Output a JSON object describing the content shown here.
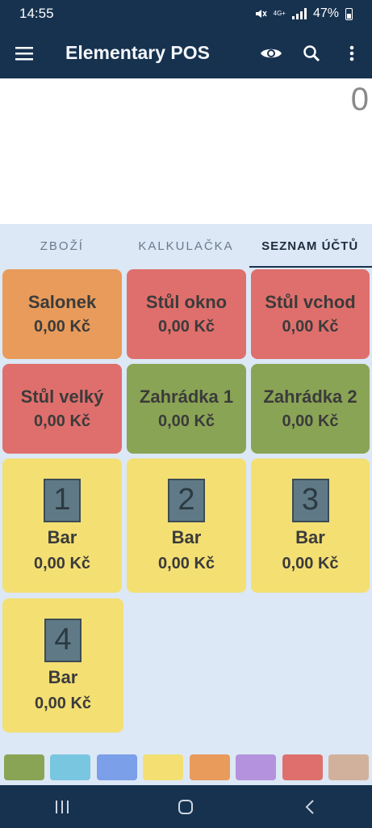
{
  "status": {
    "time": "14:55",
    "network": "4G+",
    "battery": "47%"
  },
  "app": {
    "title": "Elementary POS"
  },
  "display": {
    "value": "0"
  },
  "tabs": [
    {
      "label": "ZBOŽÍ",
      "active": false
    },
    {
      "label": "KALKULAČKA",
      "active": false
    },
    {
      "label": "SEZNAM ÚČTŮ",
      "active": true
    }
  ],
  "tiles": [
    {
      "name": "Salonek",
      "amount": "0,00 Kč",
      "color": "#e89b5a"
    },
    {
      "name": "Stůl okno",
      "amount": "0,00 Kč",
      "color": "#df6f6c"
    },
    {
      "name": "Stůl vchod",
      "amount": "0,00 Kč",
      "color": "#df6f6c"
    },
    {
      "name": "Stůl velký",
      "amount": "0,00 Kč",
      "color": "#df6f6c"
    },
    {
      "name": "Zahrádka 1",
      "amount": "0,00 Kč",
      "color": "#8aa455"
    },
    {
      "name": "Zahrádka 2",
      "amount": "0,00 Kč",
      "color": "#8aa455"
    },
    {
      "number": "1",
      "name": "Bar",
      "amount": "0,00 Kč",
      "color": "#f4df73"
    },
    {
      "number": "2",
      "name": "Bar",
      "amount": "0,00 Kč",
      "color": "#f4df73"
    },
    {
      "number": "3",
      "name": "Bar",
      "amount": "0,00 Kč",
      "color": "#f4df73"
    },
    {
      "number": "4",
      "name": "Bar",
      "amount": "0,00 Kč",
      "color": "#f4df73"
    }
  ],
  "palette": [
    "#8aa455",
    "#79c6e0",
    "#7b9fe8",
    "#f4df73",
    "#e89b5a",
    "#b592dd",
    "#df6f6c",
    "#d2b19c"
  ],
  "colors": {
    "bar": "#17324f",
    "background": "#dce8f5"
  }
}
